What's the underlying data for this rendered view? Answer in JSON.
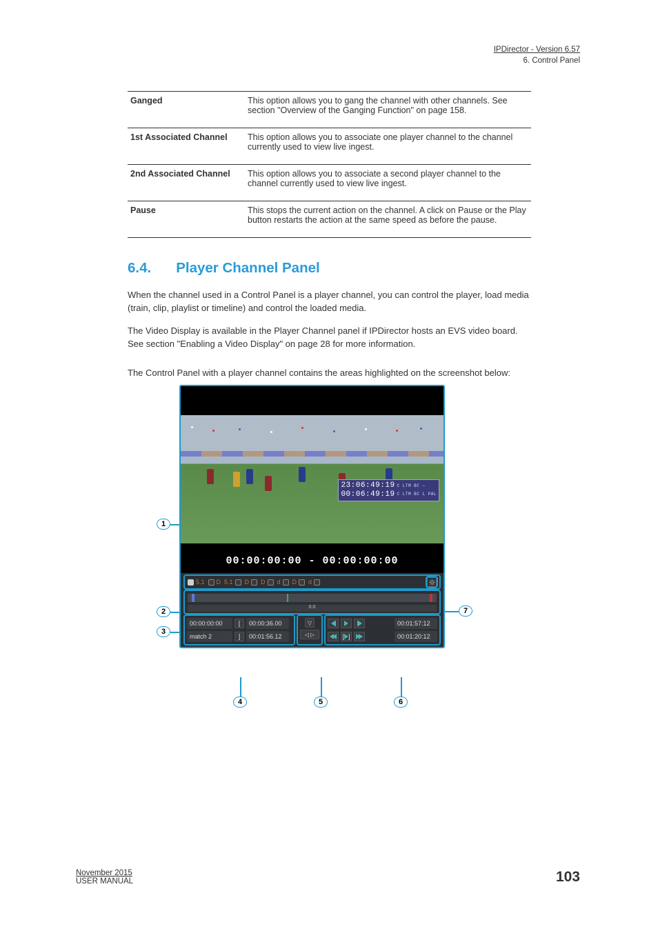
{
  "header": {
    "line1": "IPDirector - Version 6.57",
    "line2": "6. Control Panel"
  },
  "options_table": [
    {
      "opt": "Ganged",
      "desc": "This option allows you to gang the channel with other channels. See section \"Overview of the Ganging Function\" on page 158."
    },
    {
      "opt": "1st Associated Channel",
      "desc": "This option allows you to associate one player channel to the channel currently used to view live ingest."
    },
    {
      "opt": "2nd Associated Channel",
      "desc": "This option allows you to associate a second player channel to the channel currently used to view live ingest."
    },
    {
      "opt": "Pause",
      "desc": "This stops the current action on the channel. A click on Pause or the Play button restarts the action at the same speed as before the pause."
    }
  ],
  "section": {
    "num": "6.4.",
    "title": "Player Channel Panel"
  },
  "body": {
    "p1": "When the channel used in a Control Panel is a player channel, you can control the player, load media (train, clip, playlist or timeline) and control the loaded media.",
    "p2": "The Video Display is available in the Player Channel panel if IPDirector hosts an EVS video board. See section \"Enabling a Video Display\" on page 28 for more information.",
    "lead": "The Control Panel with a player channel contains the areas highlighted on the screenshot below:"
  },
  "player": {
    "scoreboard_top": "23:06:49:19",
    "scoreboard_bot": "00:06:49:19",
    "scoreboard_side_top": "C LTM\nBC\n—",
    "scoreboard_side_bot": "C LTM\nBC\nL\nPAL",
    "tc_overlay": "00:00:00:00  -  00:00:00:00",
    "audio": {
      "ch51_1": "5.1",
      "ch51_2": "5.1"
    },
    "scale_center": "0.0",
    "bottom_left": {
      "r1f1": "00:00:00:00",
      "r2f1": "match 2"
    },
    "bottom_mid": {
      "r1f2": "00:00:36.00",
      "r2f2": "00:01:56.12"
    },
    "bottom_right": {
      "dur": "00:01:57:12",
      "rem": "00:01:20:12"
    }
  },
  "callouts": [
    "1",
    "2",
    "3",
    "4",
    "5",
    "6",
    "7"
  ],
  "footer": {
    "p": "103",
    "note_line1": "November 2015",
    "note_line2": "USER MANUAL"
  }
}
